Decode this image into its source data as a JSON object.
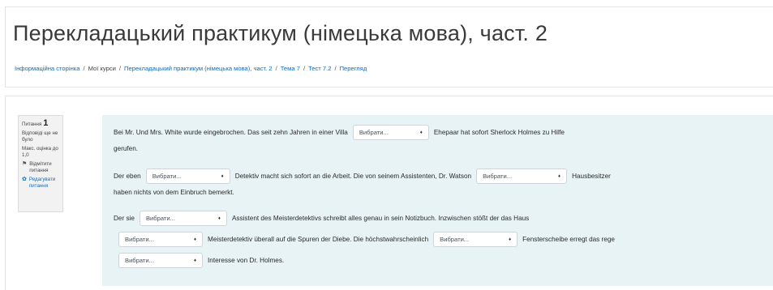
{
  "header": {
    "title": "Перекладацький практикум (німецька мова), част. 2",
    "breadcrumbs": [
      {
        "label": "Інформаційна сторінка",
        "link": true
      },
      {
        "label": "Мої курси",
        "link": false
      },
      {
        "label": "Перекладацький практикум (німецька мова), част. 2",
        "link": true
      },
      {
        "label": "Тема 7",
        "link": true
      },
      {
        "label": "Тест 7.2",
        "link": true
      },
      {
        "label": "Перегляд",
        "link": true
      }
    ],
    "separator": "/"
  },
  "question_info": {
    "number_label": "Питання",
    "number": "1",
    "state": "Відповіді ще не було",
    "marks": "Макс. оцінка до 1,0",
    "flag_label": "Відмітити питання",
    "edit_label": "Редагувати питання"
  },
  "select_placeholder": "Вибрати...",
  "question": {
    "line1": {
      "before": "Bei Mr. Und Mrs. White wurde eingebrochen. Das seit zehn Jahren in einer Villa",
      "after": "Ehepaar hat sofort Sherlock Holmes zu Hilfe"
    },
    "line2": {
      "text": "gerufen."
    },
    "line3": {
      "before": "Der eben",
      "middle": "Detektiv macht sich sofort an die Arbeit. Die von seinem Assistenten, Dr. Watson",
      "after": "Hausbesitzer"
    },
    "line4": {
      "text": "haben nichts von dem Einbruch bemerkt."
    },
    "line5": {
      "before": "Der sie",
      "after": "Assistent des Meisterdetektivs schreibt alles genau in sein Notizbuch. Inzwischen stößt der das Haus"
    },
    "line6": {
      "middle": "Meisterdetektiv überall auf die Spuren der Diebe. Die höchstwahrscheinlich",
      "after": "Fensterscheibe erregt das rege"
    },
    "line7": {
      "after": "Interesse von Dr. Holmes."
    }
  }
}
